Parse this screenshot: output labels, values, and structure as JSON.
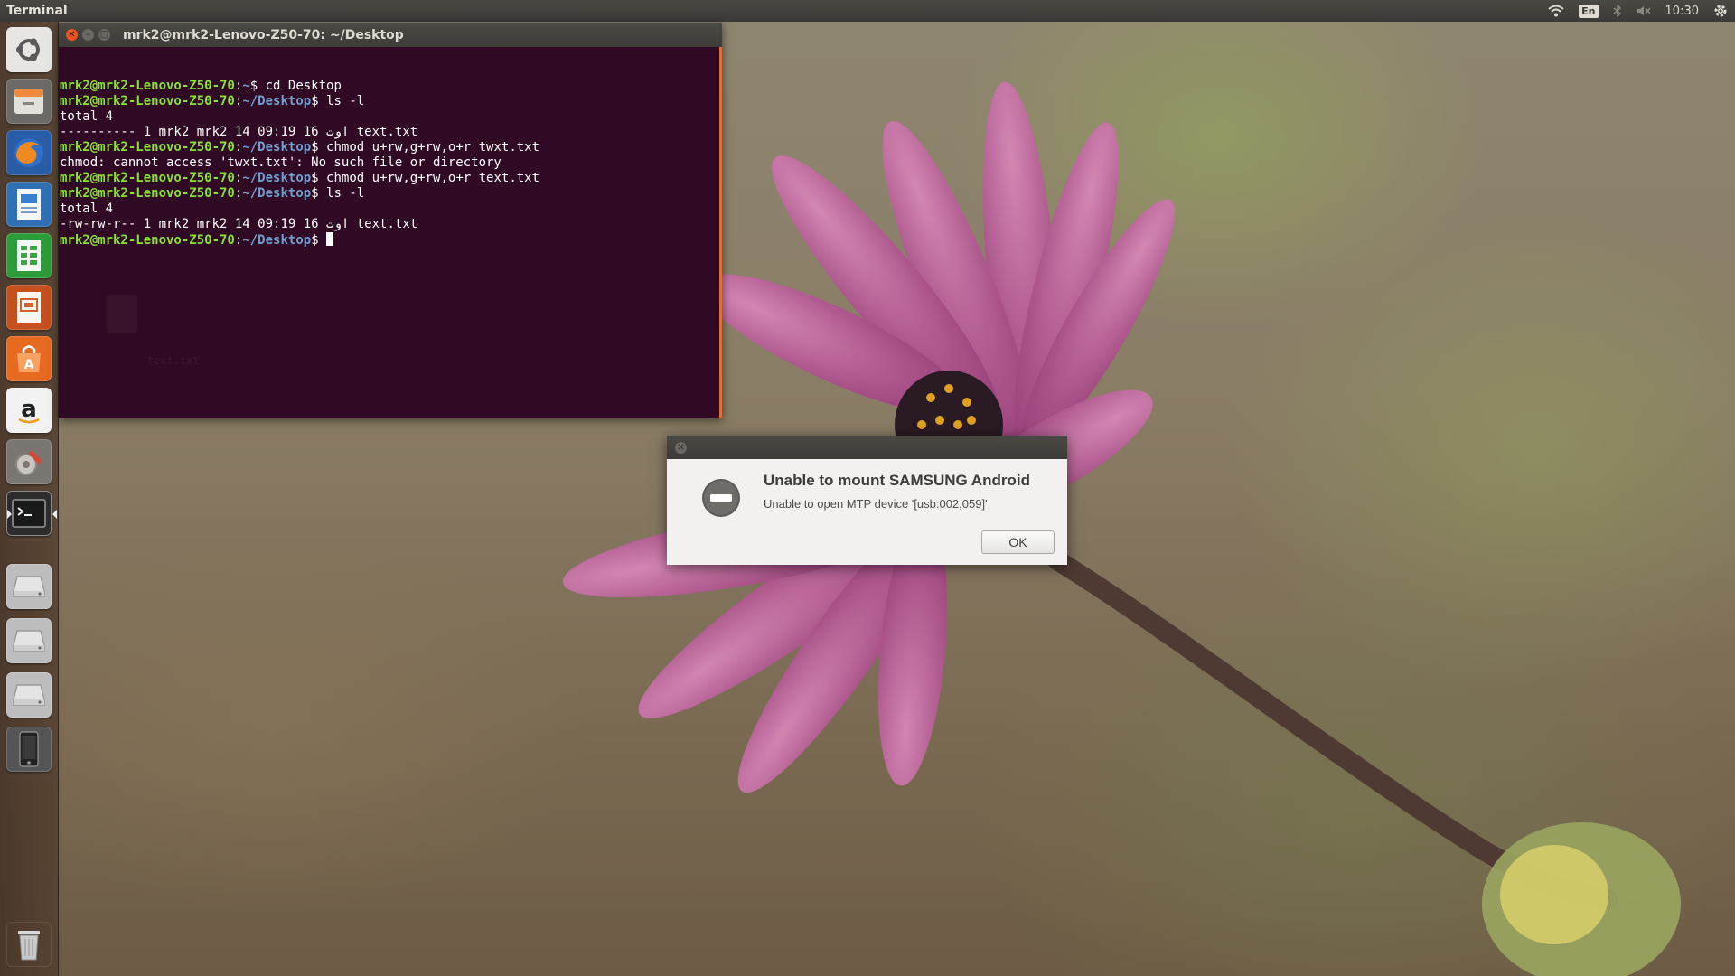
{
  "top_panel": {
    "app_name": "Terminal",
    "keyboard_layout": "En",
    "clock": "10:30",
    "icons": [
      "wifi-icon",
      "keyboard-layout-indicator",
      "bluetooth-icon",
      "volume-muted-icon",
      "settings-gear-icon"
    ]
  },
  "launcher": {
    "items": [
      {
        "name": "Dash Home",
        "icon": "ubuntu-logo-icon",
        "color": "#e8e6e2"
      },
      {
        "name": "Files",
        "icon": "file-cabinet-icon",
        "color": "#6b6a66"
      },
      {
        "name": "Firefox Web Browser",
        "icon": "firefox-icon",
        "color": "#2a5da8"
      },
      {
        "name": "LibreOffice Writer",
        "icon": "writer-doc-icon",
        "color": "#2f6fb3"
      },
      {
        "name": "LibreOffice Calc",
        "icon": "calc-sheet-icon",
        "color": "#2e9b3a"
      },
      {
        "name": "LibreOffice Impress",
        "icon": "impress-slide-icon",
        "color": "#c4501e"
      },
      {
        "name": "Ubuntu Software Center",
        "icon": "software-center-bag-icon",
        "color": "#e66a20"
      },
      {
        "name": "Amazon",
        "icon": "amazon-a-icon",
        "color": "#f2f2f2"
      },
      {
        "name": "System Settings",
        "icon": "settings-tools-icon",
        "color": "#d04b3a"
      },
      {
        "name": "Terminal",
        "icon": "terminal-icon",
        "color": "#2c2c2c"
      },
      {
        "name": "Drive 1",
        "icon": "hard-drive-icon",
        "color": "#bdbdbd"
      },
      {
        "name": "Drive 2",
        "icon": "hard-drive-icon",
        "color": "#bdbdbd"
      },
      {
        "name": "Drive 3",
        "icon": "hard-drive-icon",
        "color": "#bdbdbd"
      },
      {
        "name": "Android Device",
        "icon": "mobile-phone-icon",
        "color": "#555555"
      },
      {
        "name": "Trash",
        "icon": "trash-icon",
        "color": "#c9c9c9"
      }
    ]
  },
  "terminal": {
    "title": "mrk2@mrk2-Lenovo-Z50-70: ~/Desktop",
    "lines": [
      {
        "user": "mrk2@mrk2-Lenovo-Z50-70",
        "sep": ":",
        "path": "~",
        "dollar": "$ ",
        "text": "cd Desktop"
      },
      {
        "user": "mrk2@mrk2-Lenovo-Z50-70",
        "sep": ":",
        "path": "~/Desktop",
        "dollar": "$ ",
        "text": "ls -l"
      },
      {
        "user": "",
        "sep": "",
        "path": "",
        "dollar": "",
        "text": "total 4"
      },
      {
        "user": "",
        "sep": "",
        "path": "",
        "dollar": "",
        "text": "---------- 1 mrk2 mrk2 14 ‎اوت 16 09:19 text.txt"
      },
      {
        "user": "mrk2@mrk2-Lenovo-Z50-70",
        "sep": ":",
        "path": "~/Desktop",
        "dollar": "$ ",
        "text": "chmod u+rw,g+rw,o+r twxt.txt"
      },
      {
        "user": "",
        "sep": "",
        "path": "",
        "dollar": "",
        "text": "chmod: cannot access 'twxt.txt': No such file or directory"
      },
      {
        "user": "mrk2@mrk2-Lenovo-Z50-70",
        "sep": ":",
        "path": "~/Desktop",
        "dollar": "$ ",
        "text": "chmod u+rw,g+rw,o+r text.txt"
      },
      {
        "user": "mrk2@mrk2-Lenovo-Z50-70",
        "sep": ":",
        "path": "~/Desktop",
        "dollar": "$ ",
        "text": "ls -l"
      },
      {
        "user": "",
        "sep": "",
        "path": "",
        "dollar": "",
        "text": "total 4"
      },
      {
        "user": "",
        "sep": "",
        "path": "",
        "dollar": "",
        "text": "-rw-rw-r-- 1 mrk2 mrk2 14 ‎اوت 16 09:19 text.txt"
      },
      {
        "user": "mrk2@mrk2-Lenovo-Z50-70",
        "sep": ":",
        "path": "~/Desktop",
        "dollar": "$ ",
        "text": ""
      }
    ],
    "colors": {
      "background": "#300a24",
      "user": "#8ae234",
      "path": "#729fcf",
      "text": "#ffffff"
    }
  },
  "desktop": {
    "file_label": "text.txt"
  },
  "dialog": {
    "heading": "Unable to mount SAMSUNG Android",
    "message": "Unable to open MTP device '[usb:002,059]'",
    "ok_label": "OK",
    "icon": "error-minus-icon"
  }
}
